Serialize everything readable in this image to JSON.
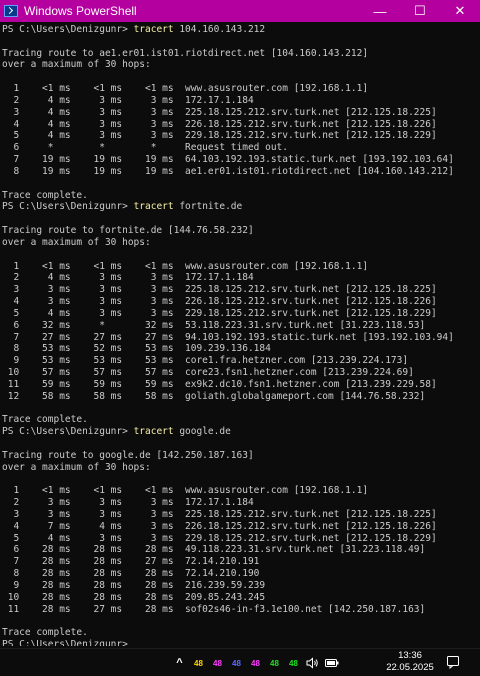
{
  "window": {
    "title": "Windows PowerShell",
    "minimize": "—",
    "maximize": "☐",
    "close": "✕"
  },
  "console": {
    "lines": [
      {
        "t": "prompt",
        "p": "PS C:\\Users\\Denizgunr> ",
        "c": "tracert",
        "a": " 104.160.143.212"
      },
      {
        "t": "text",
        "v": ""
      },
      {
        "t": "text",
        "v": "Tracing route to ae1.er01.ist01.riotdirect.net [104.160.143.212]"
      },
      {
        "t": "text",
        "v": "over a maximum of 30 hops:"
      },
      {
        "t": "text",
        "v": ""
      },
      {
        "t": "text",
        "v": "  1    <1 ms    <1 ms    <1 ms  www.asusrouter.com [192.168.1.1]"
      },
      {
        "t": "text",
        "v": "  2     4 ms     3 ms     3 ms  172.17.1.184"
      },
      {
        "t": "text",
        "v": "  3     4 ms     3 ms     3 ms  225.18.125.212.srv.turk.net [212.125.18.225]"
      },
      {
        "t": "text",
        "v": "  4     4 ms     3 ms     3 ms  226.18.125.212.srv.turk.net [212.125.18.226]"
      },
      {
        "t": "text",
        "v": "  5     4 ms     3 ms     3 ms  229.18.125.212.srv.turk.net [212.125.18.229]"
      },
      {
        "t": "text",
        "v": "  6     *        *        *     Request timed out."
      },
      {
        "t": "text",
        "v": "  7    19 ms    19 ms    19 ms  64.103.192.193.static.turk.net [193.192.103.64]"
      },
      {
        "t": "text",
        "v": "  8    19 ms    19 ms    19 ms  ae1.er01.ist01.riotdirect.net [104.160.143.212]"
      },
      {
        "t": "text",
        "v": ""
      },
      {
        "t": "text",
        "v": "Trace complete."
      },
      {
        "t": "prompt",
        "p": "PS C:\\Users\\Denizgunr> ",
        "c": "tracert",
        "a": " fortnite.de"
      },
      {
        "t": "text",
        "v": ""
      },
      {
        "t": "text",
        "v": "Tracing route to fortnite.de [144.76.58.232]"
      },
      {
        "t": "text",
        "v": "over a maximum of 30 hops:"
      },
      {
        "t": "text",
        "v": ""
      },
      {
        "t": "text",
        "v": "  1    <1 ms    <1 ms    <1 ms  www.asusrouter.com [192.168.1.1]"
      },
      {
        "t": "text",
        "v": "  2     4 ms     3 ms     3 ms  172.17.1.184"
      },
      {
        "t": "text",
        "v": "  3     3 ms     3 ms     3 ms  225.18.125.212.srv.turk.net [212.125.18.225]"
      },
      {
        "t": "text",
        "v": "  4     3 ms     3 ms     3 ms  226.18.125.212.srv.turk.net [212.125.18.226]"
      },
      {
        "t": "text",
        "v": "  5     4 ms     3 ms     3 ms  229.18.125.212.srv.turk.net [212.125.18.229]"
      },
      {
        "t": "text",
        "v": "  6    32 ms     *       32 ms  53.118.223.31.srv.turk.net [31.223.118.53]"
      },
      {
        "t": "text",
        "v": "  7    27 ms    27 ms    27 ms  94.103.192.193.static.turk.net [193.192.103.94]"
      },
      {
        "t": "text",
        "v": "  8    53 ms    52 ms    53 ms  109.239.136.184"
      },
      {
        "t": "text",
        "v": "  9    53 ms    53 ms    53 ms  core1.fra.hetzner.com [213.239.224.173]"
      },
      {
        "t": "text",
        "v": " 10    57 ms    57 ms    57 ms  core23.fsn1.hetzner.com [213.239.224.69]"
      },
      {
        "t": "text",
        "v": " 11    59 ms    59 ms    59 ms  ex9k2.dc10.fsn1.hetzner.com [213.239.229.58]"
      },
      {
        "t": "text",
        "v": " 12    58 ms    58 ms    58 ms  goliath.globalgameport.com [144.76.58.232]"
      },
      {
        "t": "text",
        "v": ""
      },
      {
        "t": "text",
        "v": "Trace complete."
      },
      {
        "t": "prompt",
        "p": "PS C:\\Users\\Denizgunr> ",
        "c": "tracert",
        "a": " google.de"
      },
      {
        "t": "text",
        "v": ""
      },
      {
        "t": "text",
        "v": "Tracing route to google.de [142.250.187.163]"
      },
      {
        "t": "text",
        "v": "over a maximum of 30 hops:"
      },
      {
        "t": "text",
        "v": ""
      },
      {
        "t": "text",
        "v": "  1    <1 ms    <1 ms    <1 ms  www.asusrouter.com [192.168.1.1]"
      },
      {
        "t": "text",
        "v": "  2     3 ms     3 ms     3 ms  172.17.1.184"
      },
      {
        "t": "text",
        "v": "  3     3 ms     3 ms     3 ms  225.18.125.212.srv.turk.net [212.125.18.225]"
      },
      {
        "t": "text",
        "v": "  4     7 ms     4 ms     3 ms  226.18.125.212.srv.turk.net [212.125.18.226]"
      },
      {
        "t": "text",
        "v": "  5     4 ms     3 ms     3 ms  229.18.125.212.srv.turk.net [212.125.18.229]"
      },
      {
        "t": "text",
        "v": "  6    28 ms    28 ms    28 ms  49.118.223.31.srv.turk.net [31.223.118.49]"
      },
      {
        "t": "text",
        "v": "  7    28 ms    28 ms    27 ms  72.14.210.191"
      },
      {
        "t": "text",
        "v": "  8    28 ms    28 ms    28 ms  72.14.210.190"
      },
      {
        "t": "text",
        "v": "  9    28 ms    28 ms    28 ms  216.239.59.239"
      },
      {
        "t": "text",
        "v": " 10    28 ms    28 ms    28 ms  209.85.243.245"
      },
      {
        "t": "text",
        "v": " 11    28 ms    27 ms    28 ms  sof02s46-in-f3.1e100.net [142.250.187.163]"
      },
      {
        "t": "text",
        "v": ""
      },
      {
        "t": "text",
        "v": "Trace complete."
      },
      {
        "t": "prompt",
        "p": "PS C:\\Users\\Denizgunr> ",
        "c": "",
        "a": ""
      }
    ]
  },
  "taskbar": {
    "tray_chevron": "^",
    "tray_icons": [
      {
        "label": "48",
        "color": "#ffd400",
        "name": "tray-monitor-icon-1"
      },
      {
        "label": "48",
        "color": "#ff3cff",
        "name": "tray-monitor-icon-2"
      },
      {
        "label": "48",
        "color": "#5a6bff",
        "name": "tray-monitor-icon-3"
      },
      {
        "label": "48",
        "color": "#ff3cff",
        "name": "tray-monitor-icon-4"
      },
      {
        "label": "48",
        "color": "#20e020",
        "name": "tray-monitor-icon-5"
      },
      {
        "label": "48",
        "color": "#20e020",
        "name": "tray-monitor-icon-6"
      }
    ],
    "time": "13:36",
    "date": "22.05.2025"
  },
  "colors": {
    "titlebar": "#b4009e",
    "background": "#0c0c0c",
    "command": "#f9f1a5",
    "text": "#cccccc"
  }
}
